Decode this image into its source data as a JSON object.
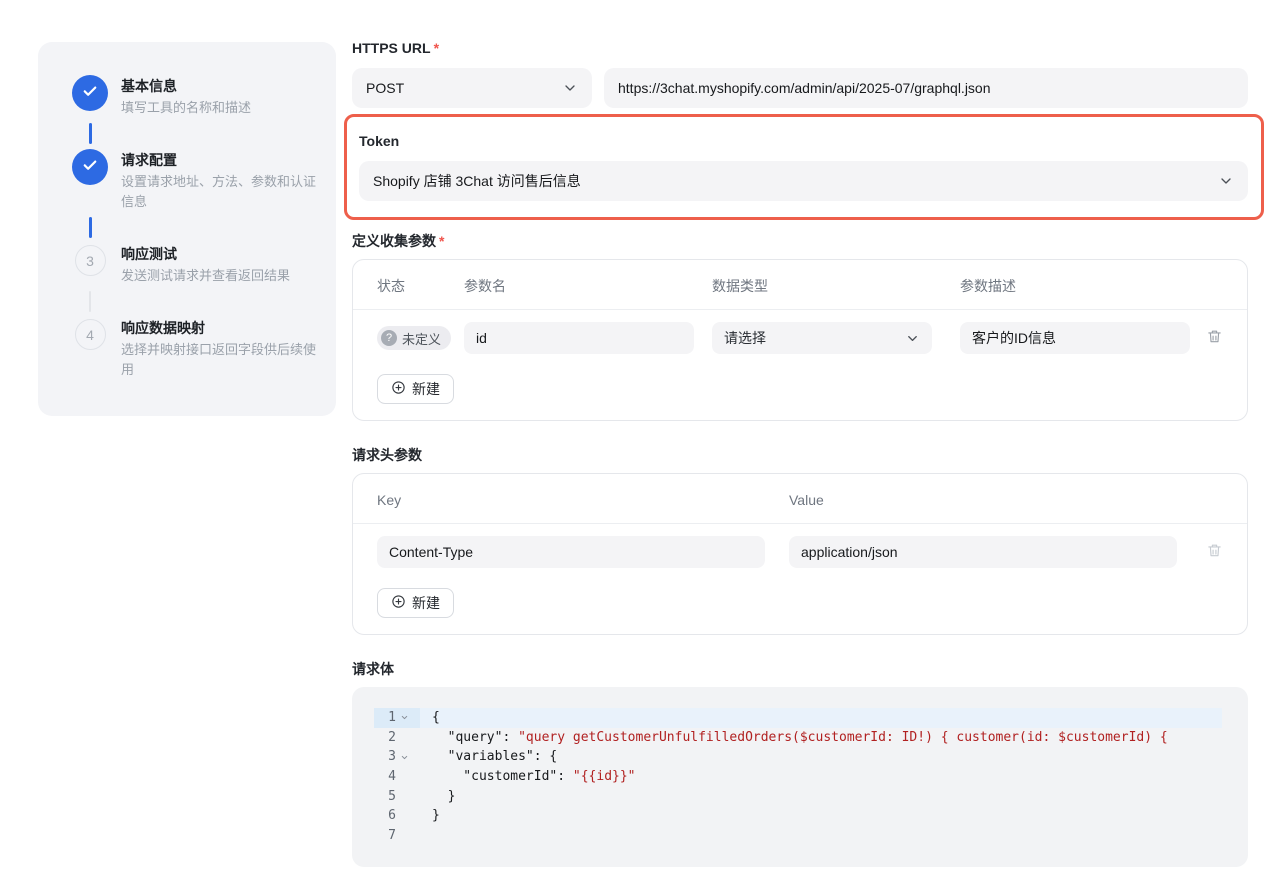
{
  "colors": {
    "accent_blue": "#2d6ae3",
    "annotation_red": "#ee5f4b",
    "required_red": "#f0544c",
    "code_string_red": "#b12121",
    "active_line_bg": "#e9f2fb",
    "input_bg": "#f4f4f6"
  },
  "stepper": {
    "steps": [
      {
        "title": "基本信息",
        "description": "填写工具的名称和描述",
        "state": "done"
      },
      {
        "title": "请求配置",
        "description": "设置请求地址、方法、参数和认证信息",
        "state": "done"
      },
      {
        "title": "响应测试",
        "description": "发送测试请求并查看返回结果",
        "number": "3",
        "state": "pending"
      },
      {
        "title": "响应数据映射",
        "description": "选择并映射接口返回字段供后续使用",
        "number": "4",
        "state": "pending"
      }
    ]
  },
  "url_section": {
    "label": "HTTPS URL",
    "required_mark": "*",
    "method": "POST",
    "url": "https://3chat.myshopify.com/admin/api/2025-07/graphql.json"
  },
  "token_section": {
    "label": "Token",
    "selected": "Shopify 店铺 3Chat 访问售后信息"
  },
  "params_section": {
    "label": "定义收集参数",
    "required_mark": "*",
    "columns": {
      "status": "状态",
      "name": "参数名",
      "type": "数据类型",
      "desc": "参数描述"
    },
    "row": {
      "status_badge": "未定义",
      "status_icon": "?",
      "name": "id",
      "type_placeholder": "请选择",
      "desc": "客户的ID信息"
    },
    "add_button": "新建"
  },
  "headers_section": {
    "label": "请求头参数",
    "columns": {
      "key": "Key",
      "value": "Value"
    },
    "row": {
      "key": "Content-Type",
      "value": "application/json"
    },
    "add_button": "新建"
  },
  "body_section": {
    "label": "请求体",
    "lines": [
      {
        "num": "1",
        "plain": "{",
        "str": ""
      },
      {
        "num": "2",
        "plain": "  \"query\": ",
        "str": "\"query getCustomerUnfulfilledOrders($customerId: ID!) { customer(id: $customerId) {"
      },
      {
        "num": "3",
        "plain": "  \"variables\": {",
        "str": ""
      },
      {
        "num": "4",
        "plain": "    \"customerId\": ",
        "str": "\"{{id}}\""
      },
      {
        "num": "5",
        "plain": "  }",
        "str": ""
      },
      {
        "num": "6",
        "plain": "}",
        "str": ""
      },
      {
        "num": "7",
        "plain": "",
        "str": ""
      }
    ]
  }
}
